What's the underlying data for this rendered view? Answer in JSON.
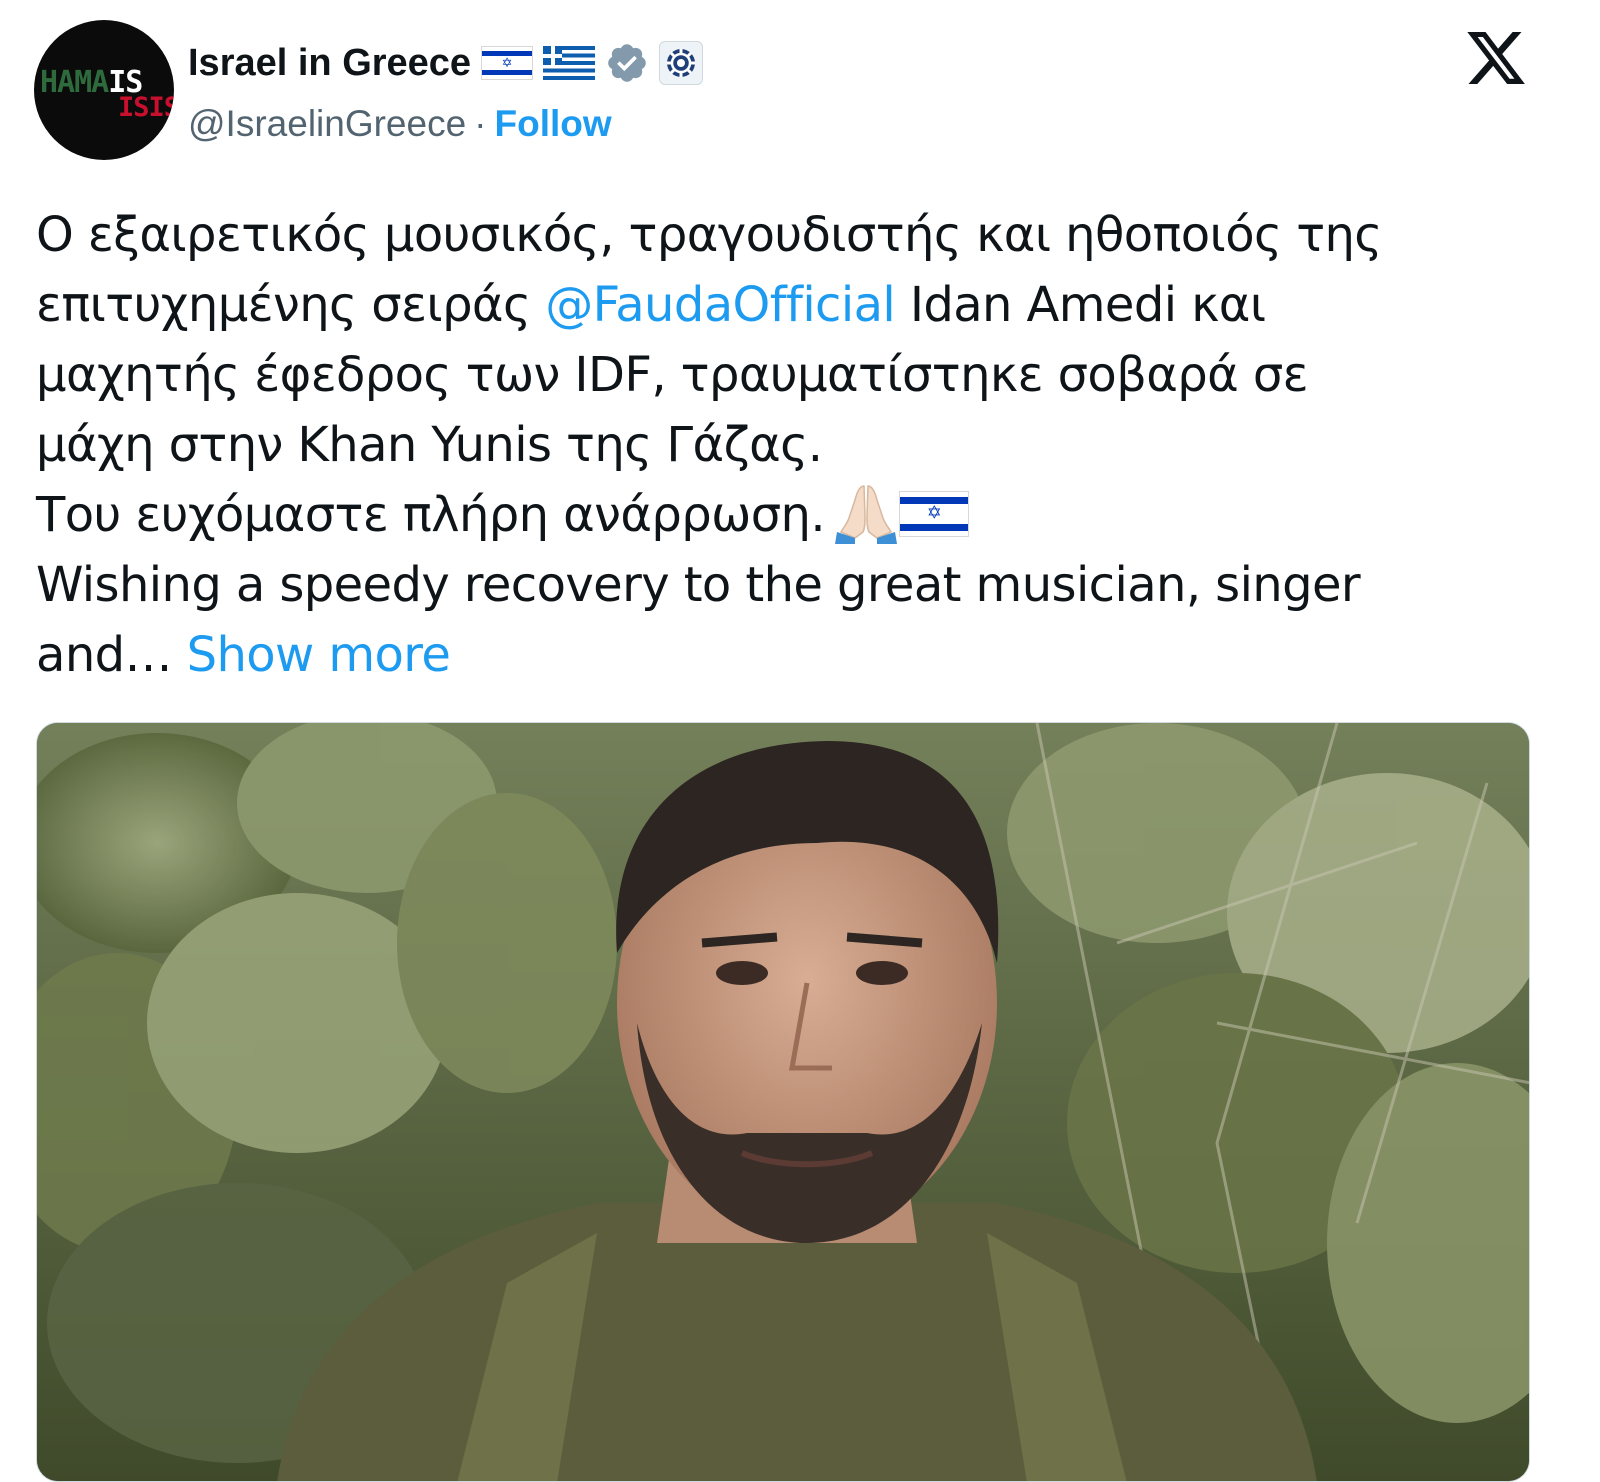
{
  "header": {
    "avatar_text_line1_a": "HAMA",
    "avatar_text_line1_b": "IS",
    "avatar_text_line2": "ISIS",
    "display_name": "Israel in Greece",
    "handle": "@IsraelinGreece",
    "separator": "·",
    "follow_label": "Follow",
    "icons": [
      "israel-flag",
      "greece-flag",
      "verified-badge",
      "affiliation-badge",
      "x-logo"
    ]
  },
  "tweet": {
    "lines": [
      "Ο εξαιρετικός μουσικός, τραγουδιστής και ηθοποιός της",
      "επιτυχημένης σειράς",
      "@FaudaOfficial",
      "Idan Amedi και",
      "μαχητής έφεδρος των IDF, τραυματίστηκε σοβαρά σε",
      "μάχη στην Khan Yunis της Γάζας.",
      "Του ευχόμαστε πλήρη ανάρρωση.",
      "Wishing a speedy recovery to the great musician, singer",
      "and…",
      "Show more"
    ]
  },
  "media": {
    "icon": "photo-of-soldier"
  },
  "colors": {
    "link": "#1d9bf0",
    "text": "#0f1419",
    "secondary": "#536471",
    "verified": "#829aab"
  }
}
